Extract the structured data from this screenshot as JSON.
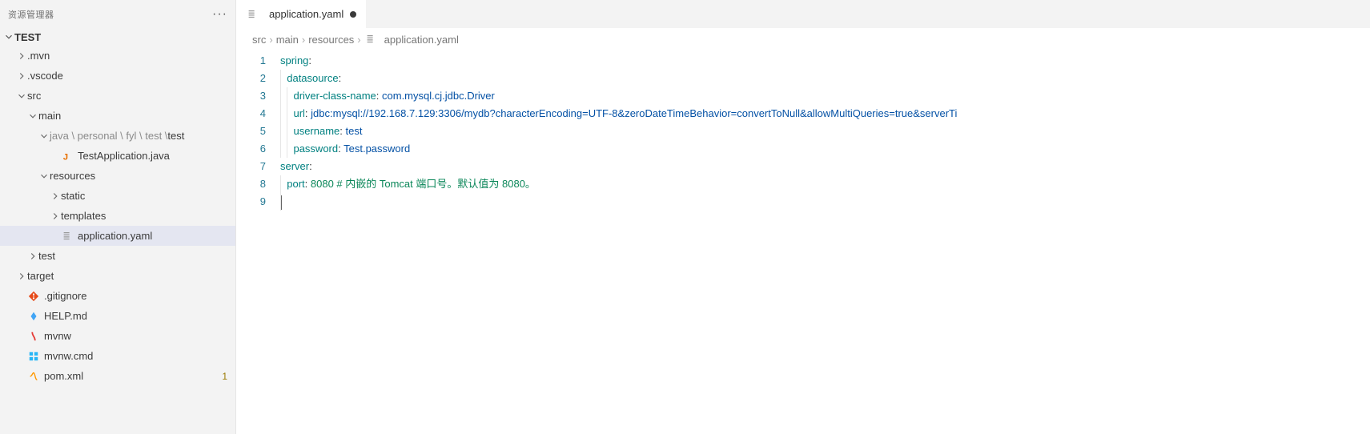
{
  "sidebar": {
    "header": "资源管理器",
    "root": "TEST",
    "items": [
      {
        "indent": 1,
        "tw": "right",
        "icon": null,
        "label": ".mvn"
      },
      {
        "indent": 1,
        "tw": "right",
        "icon": null,
        "label": ".vscode"
      },
      {
        "indent": 1,
        "tw": "down",
        "icon": null,
        "label": "src"
      },
      {
        "indent": 2,
        "tw": "down",
        "icon": null,
        "label": "main"
      },
      {
        "indent": 3,
        "tw": "down",
        "icon": null,
        "pre": "java \\ personal \\ fyl \\ test \\ ",
        "label": "test"
      },
      {
        "indent": 4,
        "tw": null,
        "icon": "java",
        "label": "TestApplication.java"
      },
      {
        "indent": 3,
        "tw": "down",
        "icon": null,
        "label": "resources"
      },
      {
        "indent": 4,
        "tw": "right",
        "icon": null,
        "label": "static"
      },
      {
        "indent": 4,
        "tw": "right",
        "icon": null,
        "label": "templates"
      },
      {
        "indent": 4,
        "tw": null,
        "icon": "yaml",
        "label": "application.yaml",
        "selected": true
      },
      {
        "indent": 2,
        "tw": "right",
        "icon": null,
        "label": "test"
      },
      {
        "indent": 1,
        "tw": "right",
        "icon": null,
        "label": "target"
      },
      {
        "indent": 1,
        "tw": null,
        "icon": "git",
        "label": ".gitignore"
      },
      {
        "indent": 1,
        "tw": null,
        "icon": "help",
        "label": "HELP.md"
      },
      {
        "indent": 1,
        "tw": null,
        "icon": "mvnw",
        "label": "mvnw"
      },
      {
        "indent": 1,
        "tw": null,
        "icon": "win",
        "label": "mvnw.cmd"
      },
      {
        "indent": 1,
        "tw": null,
        "icon": "xml",
        "label": "pom.xml",
        "badge": "1"
      }
    ]
  },
  "tab": {
    "label": "application.yaml",
    "dirty": true
  },
  "breadcrumbs": [
    "src",
    "main",
    "resources",
    "application.yaml"
  ],
  "code": {
    "lines": [
      1,
      2,
      3,
      4,
      5,
      6,
      7,
      8,
      9
    ],
    "l1": {
      "k": "spring"
    },
    "l2": {
      "k": "datasource"
    },
    "l3": {
      "k": "driver-class-name",
      "v": "com.mysql.cj.jdbc.Driver"
    },
    "l4": {
      "k": "url",
      "v": "jdbc:mysql://192.168.7.129:3306/mydb?characterEncoding=UTF-8&zeroDateTimeBehavior=convertToNull&allowMultiQueries=true&serverTi"
    },
    "l5": {
      "k": "username",
      "v": "test"
    },
    "l6": {
      "k": "password",
      "v": "Test.password"
    },
    "l7": {
      "k": "server"
    },
    "l8": {
      "k": "port",
      "n": "8080",
      "c": "# 内嵌的 Tomcat 端口号。默认值为 8080。"
    }
  }
}
